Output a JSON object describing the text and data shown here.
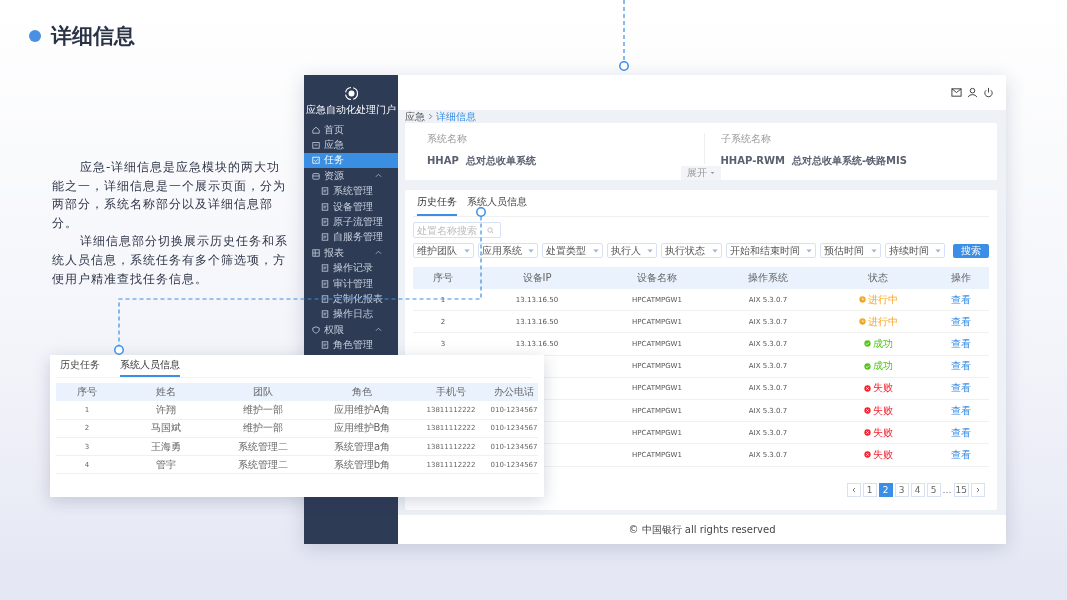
{
  "slide": {
    "title": "详细信息",
    "paragraphs": [
      "应急-详细信息是应急模块的两大功能之一，详细信息是一个展示页面，分为两部分，系统名称部分以及详细信息部分。",
      "详细信息部分切换展示历史任务和系统人员信息，系统任务有多个筛选项，方便用户精准查找任务信息。"
    ]
  },
  "app": {
    "portal_title": "应急自动化处理门户",
    "sidebar": [
      {
        "label": "首页",
        "selected": false
      },
      {
        "label": "应急",
        "selected": false
      },
      {
        "label": "任务",
        "selected": true
      },
      {
        "label": "资源",
        "selected": false,
        "expanded": true,
        "children": [
          {
            "label": "系统管理",
            "selected": false
          },
          {
            "label": "设备管理",
            "selected": false
          },
          {
            "label": "原子流管理",
            "selected": false
          },
          {
            "label": "自服务管理",
            "selected": false
          }
        ]
      },
      {
        "label": "报表",
        "selected": false,
        "expanded": true,
        "children": [
          {
            "label": "操作记录",
            "selected": false
          },
          {
            "label": "审计管理",
            "selected": false
          },
          {
            "label": "定制化报表",
            "selected": false
          },
          {
            "label": "操作日志",
            "selected": false
          }
        ]
      },
      {
        "label": "权限",
        "selected": false,
        "expanded": true,
        "children": [
          {
            "label": "角色管理",
            "selected": false
          }
        ]
      }
    ],
    "breadcrumb": [
      "应急",
      "详细信息"
    ],
    "info": [
      {
        "label": "系统名称",
        "value": "HHAP  总对总收单系统"
      },
      {
        "label": "子系统名称",
        "value": "HHAP-RWM  总对总收单系统-铁路MIS"
      }
    ],
    "expand_button": "展开",
    "tabs": [
      {
        "label": "历史任务",
        "selected": true
      },
      {
        "label": "系统人员信息",
        "selected": false
      }
    ],
    "search": {
      "placeholder": "处置名称搜索"
    },
    "filters": [
      "维护团队",
      "应用系统",
      "处置类型",
      "执行人",
      "执行状态",
      "开始和结束时间",
      "预估时间",
      "持续时间"
    ],
    "search_button": "搜索",
    "table": {
      "columns": [
        "序号",
        "设备IP",
        "设备名称",
        "操作系统",
        "状态",
        "操作"
      ],
      "rows": [
        {
          "seq": "1",
          "ip": "13.13.16.50",
          "name": "HPCATMPGW1",
          "os": "AIX 5.3.0.7",
          "status": "进行中",
          "kind": "running",
          "action": "查看"
        },
        {
          "seq": "2",
          "ip": "13.13.16.50",
          "name": "HPCATMPGW1",
          "os": "AIX 5.3.0.7",
          "status": "进行中",
          "kind": "running",
          "action": "查看"
        },
        {
          "seq": "3",
          "ip": "13.13.16.50",
          "name": "HPCATMPGW1",
          "os": "AIX 5.3.0.7",
          "status": "成功",
          "kind": "success",
          "action": "查看"
        },
        {
          "name": "HPCATMPGW1",
          "os": "AIX 5.3.0.7",
          "status": "成功",
          "kind": "success",
          "action": "查看"
        },
        {
          "name": "HPCATMPGW1",
          "os": "AIX 5.3.0.7",
          "status": "失败",
          "kind": "failed",
          "action": "查看"
        },
        {
          "name": "HPCATMPGW1",
          "os": "AIX 5.3.0.7",
          "status": "失败",
          "kind": "failed",
          "action": "查看"
        },
        {
          "name": "HPCATMPGW1",
          "os": "AIX 5.3.0.7",
          "status": "失败",
          "kind": "failed",
          "action": "查看"
        },
        {
          "name": "HPCATMPGW1",
          "os": "AIX 5.3.0.7",
          "status": "失败",
          "kind": "failed",
          "action": "查看"
        }
      ]
    },
    "pagination": [
      {
        "label": "1",
        "selected": false
      },
      {
        "label": "2",
        "selected": true
      },
      {
        "label": "3",
        "selected": false
      },
      {
        "label": "4",
        "selected": false
      },
      {
        "label": "5",
        "selected": false
      },
      {
        "label": "…",
        "kind": "ellipsis"
      },
      {
        "label": "15",
        "selected": false
      }
    ],
    "footer": "© 中国银行 all rights reserved"
  },
  "popup": {
    "tabs": [
      {
        "label": "历史任务",
        "selected": false
      },
      {
        "label": "系统人员信息",
        "selected": true
      }
    ],
    "columns": [
      "序号",
      "姓名",
      "团队",
      "角色",
      "手机号",
      "办公电话"
    ],
    "rows": [
      [
        "1",
        "许翔",
        "维护一部",
        "应用维护A角",
        "13811112222",
        "010-1234567"
      ],
      [
        "2",
        "马国斌",
        "维护一部",
        "应用维护B角",
        "13811112222",
        "010-1234567"
      ],
      [
        "3",
        "王海勇",
        "系统管理二",
        "系统管理a角",
        "13811112222",
        "010-1234567"
      ],
      [
        "4",
        "管宇",
        "系统管理二",
        "系统管理b角",
        "13811112222",
        "010-1234567"
      ]
    ]
  }
}
